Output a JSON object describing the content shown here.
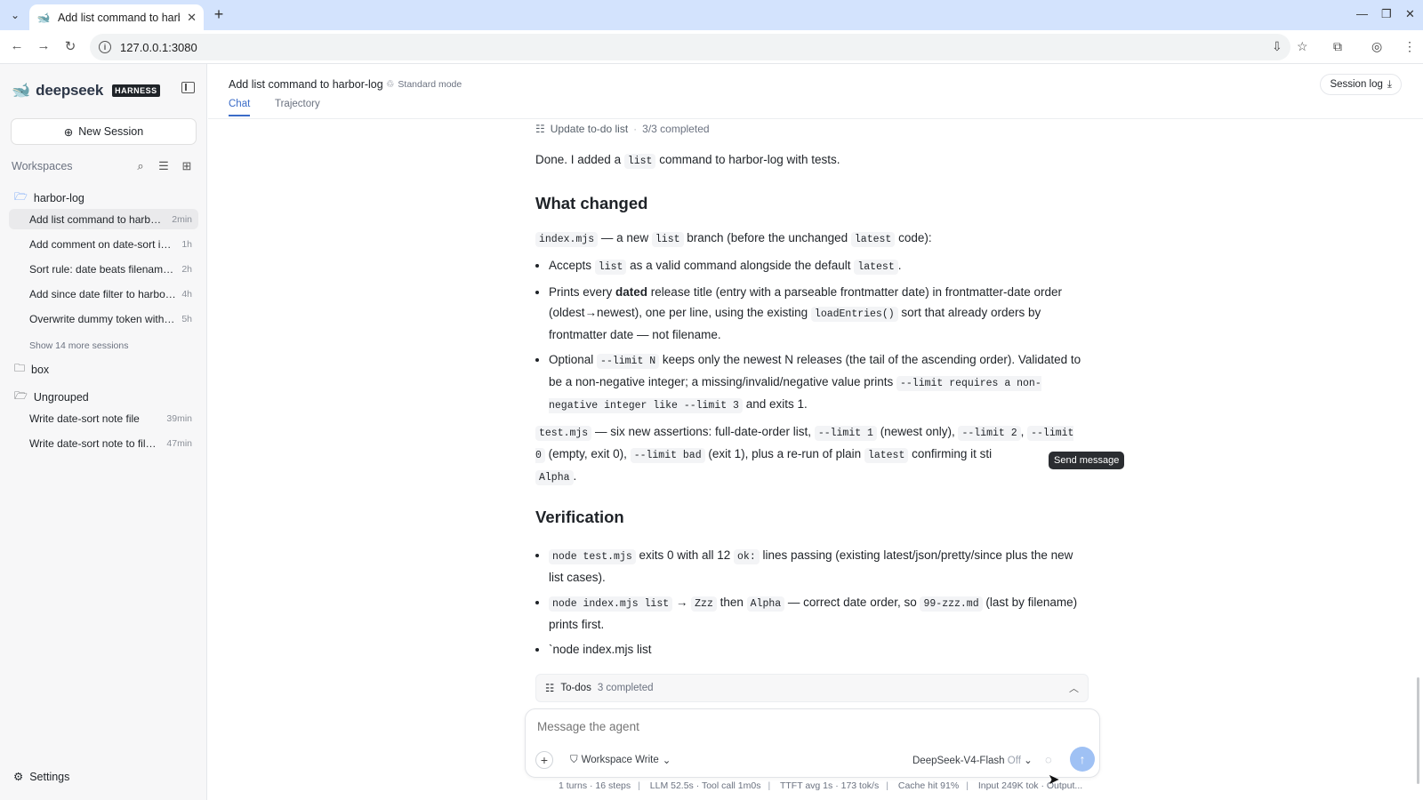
{
  "browser": {
    "tab_title": "Add list command to harb",
    "url": "127.0.0.1:3080"
  },
  "sidebar": {
    "brand_name": "deepseek",
    "brand_badge": "HARNESS",
    "new_session_label": "New Session",
    "workspaces_label": "Workspaces",
    "folders": [
      {
        "name": "harbor-log",
        "sessions": [
          {
            "title": "Add list command to harbor-log",
            "time": "2min"
          },
          {
            "title": "Add comment on date-sort in index.mjs",
            "time": "1h"
          },
          {
            "title": "Sort rule: date beats filename order",
            "time": "2h"
          },
          {
            "title": "Add since date filter to harbor-log",
            "time": "4h"
          },
          {
            "title": "Overwrite dummy token with real one",
            "time": "5h"
          }
        ],
        "show_more": "Show 14 more sessions"
      },
      {
        "name": "box"
      },
      {
        "name": "Ungrouped",
        "sessions": [
          {
            "title": "Write date-sort note file",
            "time": "39min"
          },
          {
            "title": "Write date-sort note to file in repo",
            "time": "47min"
          }
        ]
      }
    ],
    "settings_label": "Settings"
  },
  "header": {
    "title": "Add list command to harbor-log",
    "mode": "Standard mode",
    "tabs": [
      "Chat",
      "Trajectory"
    ],
    "session_log_label": "Session log"
  },
  "chat": {
    "todo_line_label": "Update to-do list",
    "todo_line_count": "3/3 completed",
    "intro": {
      "a": "Done. I added a ",
      "code": "list",
      "b": " command to harbor-log with tests."
    },
    "heading_changed": "What changed",
    "index_line": {
      "code1": "index.mjs",
      "a": " — a new ",
      "code2": "list",
      "b": " branch (before the unchanged ",
      "code3": "latest",
      "c": " code):"
    },
    "bullets1": {
      "b1": {
        "a": "Accepts ",
        "code1": "list",
        "b": " as a valid command alongside the default ",
        "code2": "latest",
        "c": "."
      },
      "b2": {
        "a": "Prints every ",
        "strong": "dated",
        "b": " release title (entry with a parseable frontmatter date) in frontmatter-date order (oldest→newest), one per line, using the existing ",
        "code": "loadEntries()",
        "c": " sort that already orders by frontmatter date — not filename."
      },
      "b3": {
        "a": "Optional ",
        "code1": "--limit N",
        "b": " keeps only the newest N releases (the tail of the ascending order). Validated to be a non-negative integer; a missing/invalid/negative value prints ",
        "code2": "--limit requires a non-negative integer like --limit 3",
        "c": " and exits 1."
      }
    },
    "test_line": {
      "code1": "test.mjs",
      "a": " — six new assertions: full-date-order list, ",
      "code2": "--limit 1",
      "b": " (newest only), ",
      "code3": "--limit 2",
      "c": ", ",
      "code4": "--limit 0",
      "d": " (empty, exit 0), ",
      "code5": "--limit bad",
      "e": " (exit 1), plus a re-run of plain ",
      "code6": "latest",
      "f": " confirming it sti",
      "code7": "Alpha",
      "g": "."
    },
    "heading_verification": "Verification",
    "bullets2": {
      "b1": {
        "code1": "node test.mjs",
        "a": " exits 0 with all 12 ",
        "code2": "ok:",
        "b": " lines passing (existing latest/json/pretty/since plus the new list cases)."
      },
      "b2": {
        "code1": "node index.mjs list",
        "a": " → ",
        "code2": "Zzz",
        "b": " then ",
        "code3": "Alpha",
        "c": " — correct date order, so ",
        "code4": "99-zzz.md",
        "d": " (last by filename) prints first."
      },
      "b3": {
        "a": "`node index.mjs list"
      }
    },
    "tooltip": "Send message"
  },
  "todos_bar": {
    "label": "To-dos",
    "count": "3 completed"
  },
  "composer": {
    "placeholder": "Message the agent",
    "workspace_mode": "Workspace Write",
    "model": "DeepSeek-V4-Flash",
    "model_state": "Off"
  },
  "stats": {
    "turns": "1 turns · 16 steps",
    "llm": "LLM 52.5s · Tool call 1m0s",
    "ttft": "TTFT avg 1s · 173 tok/s",
    "cache": "Cache hit 91%",
    "io": "Input 249K tok · Output..."
  },
  "colors": {
    "accent": "#3b6cc8",
    "tabstrip": "#d3e3fd",
    "send_button": "#9fc1f4"
  }
}
